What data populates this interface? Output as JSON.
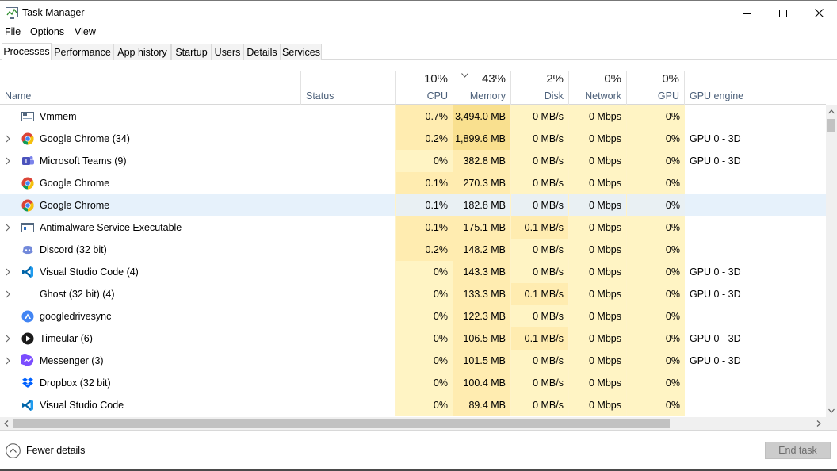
{
  "window": {
    "title": "Task Manager"
  },
  "menu": [
    "File",
    "Options",
    "View"
  ],
  "tabs": [
    "Processes",
    "Performance",
    "App history",
    "Startup",
    "Users",
    "Details",
    "Services"
  ],
  "active_tab": "Processes",
  "columns": {
    "name": "Name",
    "status": "Status",
    "cpu": {
      "pct": "10%",
      "label": "CPU"
    },
    "memory": {
      "pct": "43%",
      "label": "Memory"
    },
    "disk": {
      "pct": "2%",
      "label": "Disk"
    },
    "network": {
      "pct": "0%",
      "label": "Network"
    },
    "gpu": {
      "pct": "0%",
      "label": "GPU"
    },
    "gpu_engine": "GPU engine"
  },
  "sorted_column": "Memory",
  "processes": [
    {
      "name": "Vmmem",
      "icon": "vmmem-icon",
      "expandable": false,
      "cpu": "0.7%",
      "memory": "3,494.0 MB",
      "disk": "0 MB/s",
      "network": "0 Mbps",
      "gpu": "0%",
      "gpu_engine": ""
    },
    {
      "name": "Google Chrome (34)",
      "icon": "chrome-icon",
      "expandable": true,
      "cpu": "0.2%",
      "memory": "1,899.6 MB",
      "disk": "0 MB/s",
      "network": "0 Mbps",
      "gpu": "0%",
      "gpu_engine": "GPU 0 - 3D"
    },
    {
      "name": "Microsoft Teams (9)",
      "icon": "teams-icon",
      "expandable": true,
      "cpu": "0%",
      "memory": "382.8 MB",
      "disk": "0 MB/s",
      "network": "0 Mbps",
      "gpu": "0%",
      "gpu_engine": "GPU 0 - 3D"
    },
    {
      "name": "Google Chrome",
      "icon": "chrome-icon",
      "expandable": false,
      "cpu": "0.1%",
      "memory": "270.3 MB",
      "disk": "0 MB/s",
      "network": "0 Mbps",
      "gpu": "0%",
      "gpu_engine": ""
    },
    {
      "name": "Google Chrome",
      "icon": "chrome-icon",
      "expandable": false,
      "cpu": "0.1%",
      "memory": "182.8 MB",
      "disk": "0 MB/s",
      "network": "0 Mbps",
      "gpu": "0%",
      "gpu_engine": "",
      "selected": true
    },
    {
      "name": "Antimalware Service Executable",
      "icon": "antimalware-icon",
      "expandable": true,
      "cpu": "0.1%",
      "memory": "175.1 MB",
      "disk": "0.1 MB/s",
      "network": "0 Mbps",
      "gpu": "0%",
      "gpu_engine": ""
    },
    {
      "name": "Discord (32 bit)",
      "icon": "discord-icon",
      "expandable": false,
      "cpu": "0.2%",
      "memory": "148.2 MB",
      "disk": "0 MB/s",
      "network": "0 Mbps",
      "gpu": "0%",
      "gpu_engine": ""
    },
    {
      "name": "Visual Studio Code (4)",
      "icon": "vscode-icon",
      "expandable": true,
      "cpu": "0%",
      "memory": "143.3 MB",
      "disk": "0 MB/s",
      "network": "0 Mbps",
      "gpu": "0%",
      "gpu_engine": "GPU 0 - 3D"
    },
    {
      "name": "Ghost (32 bit) (4)",
      "icon": "",
      "expandable": true,
      "cpu": "0%",
      "memory": "133.3 MB",
      "disk": "0.1 MB/s",
      "network": "0 Mbps",
      "gpu": "0%",
      "gpu_engine": "GPU 0 - 3D"
    },
    {
      "name": "googledrivesync",
      "icon": "google-drive-icon",
      "expandable": false,
      "cpu": "0%",
      "memory": "122.3 MB",
      "disk": "0 MB/s",
      "network": "0 Mbps",
      "gpu": "0%",
      "gpu_engine": ""
    },
    {
      "name": "Timeular (6)",
      "icon": "timeular-icon",
      "expandable": true,
      "cpu": "0%",
      "memory": "106.5 MB",
      "disk": "0.1 MB/s",
      "network": "0 Mbps",
      "gpu": "0%",
      "gpu_engine": "GPU 0 - 3D"
    },
    {
      "name": "Messenger (3)",
      "icon": "messenger-icon",
      "expandable": true,
      "cpu": "0%",
      "memory": "101.5 MB",
      "disk": "0 MB/s",
      "network": "0 Mbps",
      "gpu": "0%",
      "gpu_engine": "GPU 0 - 3D"
    },
    {
      "name": "Dropbox (32 bit)",
      "icon": "dropbox-icon",
      "expandable": false,
      "cpu": "0%",
      "memory": "100.4 MB",
      "disk": "0 MB/s",
      "network": "0 Mbps",
      "gpu": "0%",
      "gpu_engine": ""
    },
    {
      "name": "Visual Studio Code",
      "icon": "vscode-icon",
      "expandable": false,
      "cpu": "0%",
      "memory": "89.4 MB",
      "disk": "0 MB/s",
      "network": "0 Mbps",
      "gpu": "0%",
      "gpu_engine": ""
    }
  ],
  "footer": {
    "fewer_details": "Fewer details",
    "end_task": "End task"
  },
  "colors": {
    "heat_low": "#fff4c4",
    "heat_mid": "#ffecb0",
    "heat_high": "#f9e08f",
    "selected_row": "#e6f1fb",
    "header_label": "#4c607a"
  }
}
